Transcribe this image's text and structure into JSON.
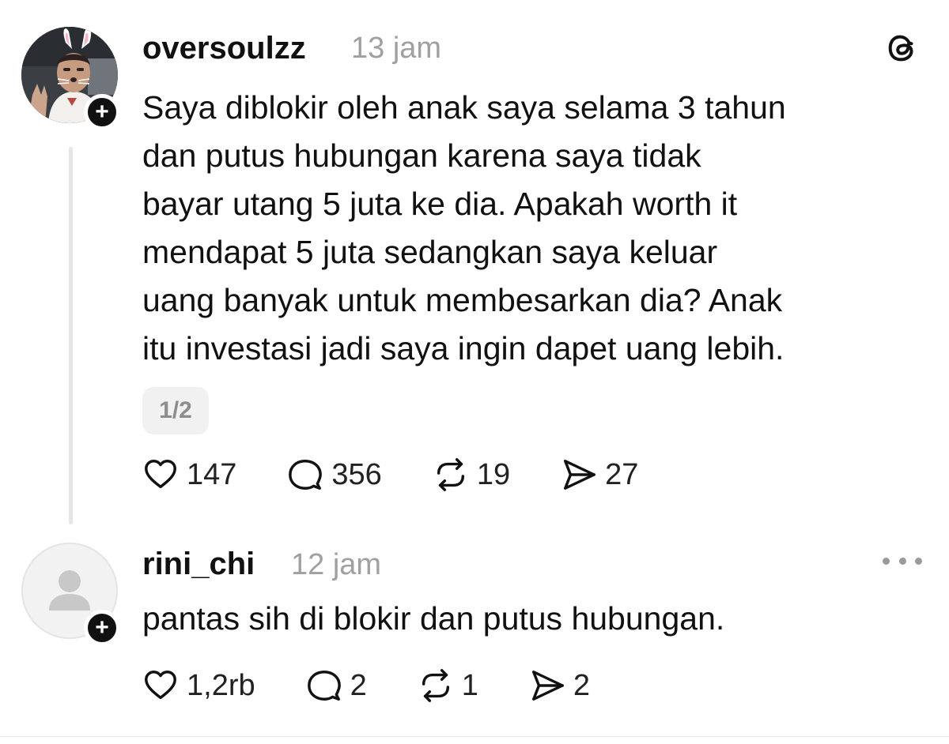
{
  "post": {
    "username": "oversoulzz",
    "time": "13 jam",
    "text_lines": [
      "Saya diblokir oleh anak saya selama 3 tahun",
      "dan putus hubungan karena saya tidak",
      "bayar utang 5 juta ke dia. Apakah worth it",
      "mendapat 5 juta sedangkan saya keluar",
      "uang banyak untuk membesarkan dia? Anak",
      "itu investasi jadi saya ingin dapet uang lebih."
    ],
    "page_indicator": "1/2",
    "likes": "147",
    "replies": "356",
    "reposts": "19",
    "shares": "27"
  },
  "reply": {
    "username": "rini_chi",
    "time": "12 jam",
    "text": "pantas sih di blokir dan putus hubungan.",
    "likes": "1,2rb",
    "replies": "2",
    "reposts": "1",
    "shares": "2"
  },
  "icons": {
    "brand": "threads-logo-icon",
    "like": "heart-icon",
    "reply": "comment-bubble-icon",
    "repost": "repost-icon",
    "share": "share-send-icon",
    "more": "more-dots-icon",
    "follow": "plus-icon",
    "avatar_placeholder": "person-icon"
  },
  "colors": {
    "text": "#111111",
    "muted": "#a0a0a0",
    "thread_line": "#e6e6e6",
    "badge": "#111111"
  }
}
